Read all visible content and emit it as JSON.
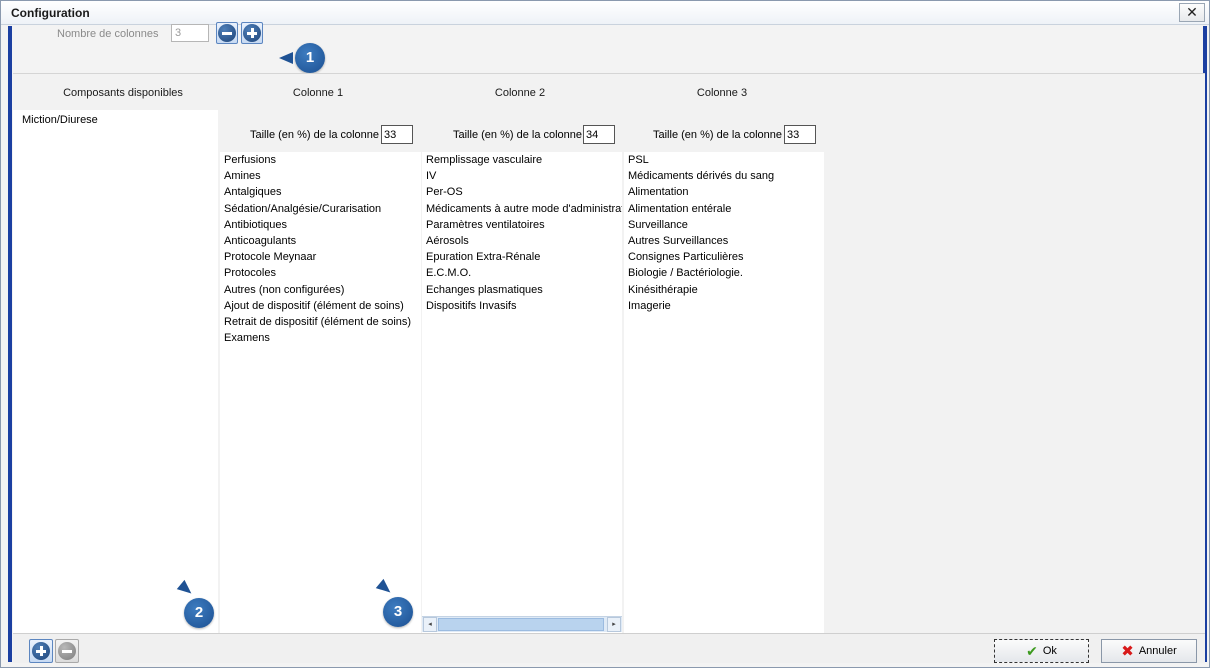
{
  "window": {
    "title": "Configuration",
    "close_glyph": "✕"
  },
  "toolbar": {
    "nb_colonnes_label": "Nombre de colonnes",
    "nb_colonnes_value": "3",
    "remove_column_icon": "minus-circle-icon",
    "add_column_icon": "plus-circle-icon"
  },
  "callouts": [
    "1",
    "2",
    "3"
  ],
  "available": {
    "header": "Composants disponibles",
    "items": [
      "Miction/Diurese"
    ]
  },
  "columns": [
    {
      "header": "Colonne 1",
      "size_label": "Taille (en %) de la colonne",
      "size_value": "33",
      "items": [
        "Perfusions",
        "Amines",
        "Antalgiques",
        "Sédation/Analgésie/Curarisation",
        "Antibiotiques",
        "Anticoagulants",
        "Protocole Meynaar",
        "Protocoles",
        "Autres (non configurées)",
        "Ajout de dispositif (élément de soins)",
        "Retrait de dispositif (élément de soins)",
        "Examens"
      ]
    },
    {
      "header": "Colonne 2",
      "size_label": "Taille (en %) de la colonne",
      "size_value": "34",
      "items": [
        "Remplissage vasculaire",
        "IV",
        "Per-OS",
        "Médicaments à autre mode d'administrat",
        "Paramètres ventilatoires",
        "Aérosols",
        "Epuration Extra-Rénale",
        "E.C.M.O.",
        "Echanges plasmatiques",
        "Dispositifs Invasifs"
      ]
    },
    {
      "header": "Colonne 3",
      "size_label": "Taille (en %) de la colonne",
      "size_value": "33",
      "items": [
        "PSL",
        "Médicaments dérivés du sang",
        "Alimentation",
        "Alimentation entérale",
        "Surveillance",
        "Autres Surveillances",
        "Consignes Particulières",
        "Biologie / Bactériologie.",
        "Kinésithérapie",
        "Imagerie"
      ]
    }
  ],
  "footer": {
    "ok_label": "Ok",
    "cancel_label": "Annuler"
  },
  "colors": {
    "accent": "#1b3fa1",
    "callout": "#2463a8"
  }
}
